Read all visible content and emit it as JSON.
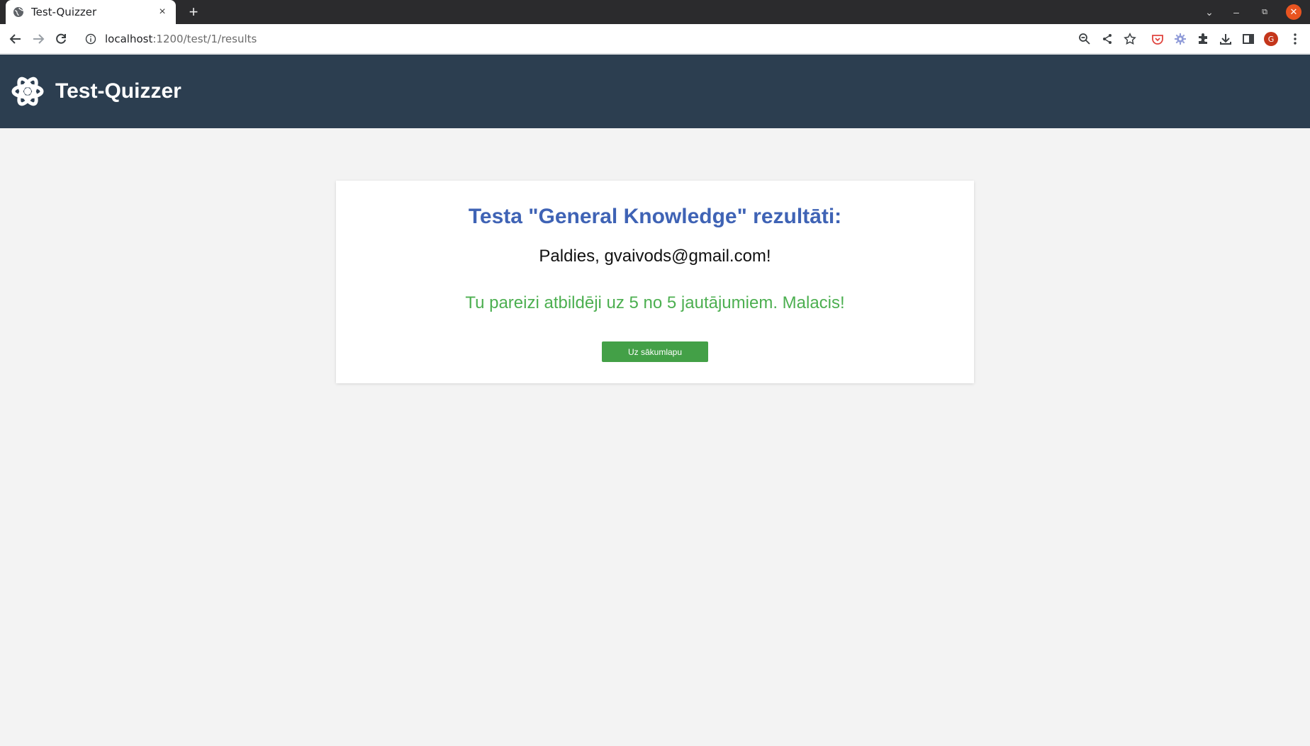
{
  "browser": {
    "tab_title": "Test-Quizzer",
    "tab_close": "×",
    "new_tab": "+",
    "url_host": "localhost",
    "url_path": ":1200/test/1/results",
    "profile_initial": "G",
    "window_controls": {
      "dropdown": "⌄",
      "minimize": "–",
      "restore": "⧉",
      "close": "✕"
    }
  },
  "header": {
    "brand": "Test-Quizzer",
    "logo_icon": "atom-icon",
    "background": "#2c3e50"
  },
  "results": {
    "title": "Testa \"General Knowledge\" rezultāti:",
    "thanks": "Paldies, gvaivods@gmail.com!",
    "score_text": "Tu pareizi atbildēji uz 5 no 5 jautājumiem. Malacis!",
    "correct": 5,
    "total": 5,
    "home_button": "Uz sākumlapu",
    "colors": {
      "title": "#3f63b5",
      "score": "#4caf50",
      "button": "#43a047"
    }
  }
}
